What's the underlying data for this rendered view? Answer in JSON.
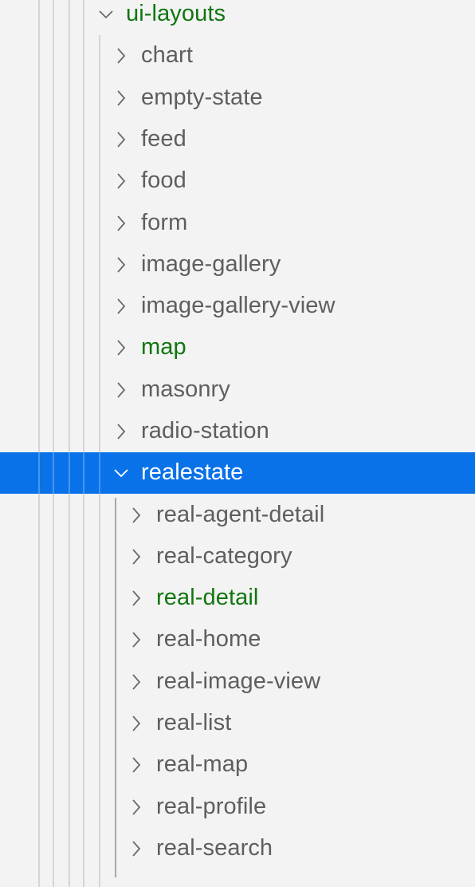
{
  "tree": {
    "root": {
      "label": "ui-layouts",
      "expanded": true,
      "modified": true
    },
    "children": [
      {
        "label": "chart",
        "expanded": false,
        "modified": false
      },
      {
        "label": "empty-state",
        "expanded": false,
        "modified": false
      },
      {
        "label": "feed",
        "expanded": false,
        "modified": false
      },
      {
        "label": "food",
        "expanded": false,
        "modified": false
      },
      {
        "label": "form",
        "expanded": false,
        "modified": false
      },
      {
        "label": "image-gallery",
        "expanded": false,
        "modified": false
      },
      {
        "label": "image-gallery-view",
        "expanded": false,
        "modified": false
      },
      {
        "label": "map",
        "expanded": false,
        "modified": true
      },
      {
        "label": "masonry",
        "expanded": false,
        "modified": false
      },
      {
        "label": "radio-station",
        "expanded": false,
        "modified": false
      },
      {
        "label": "realestate",
        "expanded": true,
        "modified": false,
        "selected": true
      }
    ],
    "realestate_children": [
      {
        "label": "real-agent-detail",
        "modified": false
      },
      {
        "label": "real-category",
        "modified": false
      },
      {
        "label": "real-detail",
        "modified": true
      },
      {
        "label": "real-home",
        "modified": false
      },
      {
        "label": "real-image-view",
        "modified": false
      },
      {
        "label": "real-list",
        "modified": false
      },
      {
        "label": "real-map",
        "modified": false
      },
      {
        "label": "real-profile",
        "modified": false
      },
      {
        "label": "real-search",
        "modified": false
      }
    ]
  },
  "colors": {
    "selected_bg": "#0a72e8",
    "modified_text": "#10760f",
    "text": "#5e5e5e"
  }
}
